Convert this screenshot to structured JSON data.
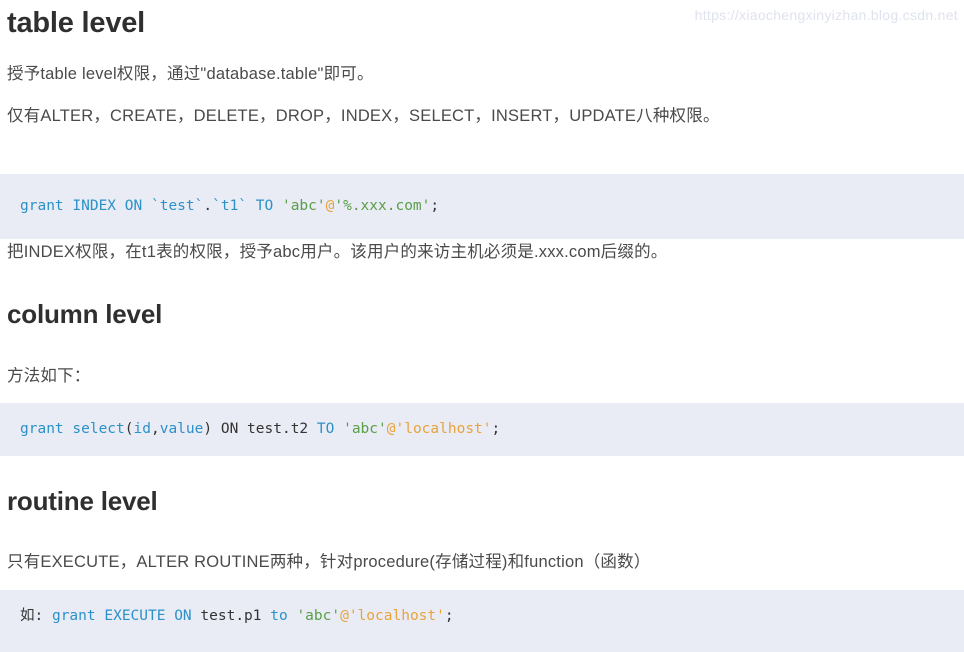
{
  "document": {
    "sections": [
      {
        "heading": "table level",
        "paragraphs": [
          "授予table level权限，通过\"database.table\"即可。",
          "仅有ALTER，CREATE，DELETE，DROP，INDEX，SELECT，INSERT，UPDATE八种权限。"
        ],
        "after_code_paragraph": "把INDEX权限，在t1表的权限，授予abc用户。该用户的来访主机必须是.xxx.com后缀的。"
      },
      {
        "heading": "column level",
        "paragraphs": [
          "方法如下："
        ]
      },
      {
        "heading": "routine level",
        "paragraphs": [
          "只有EXECUTE，ALTER ROUTINE两种，针对procedure(存储过程)和function（函数）"
        ]
      }
    ],
    "code_blocks": [
      {
        "id": "grant-index-table",
        "plain_text": "grant INDEX ON `test`.`t1` TO 'abc'@'%.xxx.com';",
        "tokens": [
          {
            "text": "grant",
            "type": "kw"
          },
          {
            "text": " ",
            "type": "plain"
          },
          {
            "text": "INDEX",
            "type": "kw"
          },
          {
            "text": " ",
            "type": "plain"
          },
          {
            "text": "ON",
            "type": "kw"
          },
          {
            "text": " ",
            "type": "plain"
          },
          {
            "text": "`test`",
            "type": "id"
          },
          {
            "text": ".",
            "type": "punc"
          },
          {
            "text": "`t1`",
            "type": "id"
          },
          {
            "text": " ",
            "type": "plain"
          },
          {
            "text": "TO",
            "type": "kw"
          },
          {
            "text": " ",
            "type": "plain"
          },
          {
            "text": "'abc'",
            "type": "str"
          },
          {
            "text": "@",
            "type": "at"
          },
          {
            "text": "'%.xxx.com'",
            "type": "str"
          },
          {
            "text": ";",
            "type": "punc"
          }
        ]
      },
      {
        "id": "grant-select-column",
        "plain_text": "grant select(id,value) ON test.t2 TO 'abc'@'localhost';",
        "tokens": [
          {
            "text": "grant",
            "type": "kw"
          },
          {
            "text": " ",
            "type": "plain"
          },
          {
            "text": "select",
            "type": "kw"
          },
          {
            "text": "(",
            "type": "punc"
          },
          {
            "text": "id",
            "type": "id"
          },
          {
            "text": ",",
            "type": "punc"
          },
          {
            "text": "value",
            "type": "id"
          },
          {
            "text": ")",
            "type": "punc"
          },
          {
            "text": " ",
            "type": "plain"
          },
          {
            "text": "ON",
            "type": "plain"
          },
          {
            "text": " ",
            "type": "plain"
          },
          {
            "text": "test.t2",
            "type": "plain"
          },
          {
            "text": " ",
            "type": "plain"
          },
          {
            "text": "TO",
            "type": "kw"
          },
          {
            "text": " ",
            "type": "plain"
          },
          {
            "text": "'abc'",
            "type": "str"
          },
          {
            "text": "@",
            "type": "at"
          },
          {
            "text": "'localhost'",
            "type": "str2"
          },
          {
            "text": ";",
            "type": "punc"
          }
        ]
      },
      {
        "id": "grant-execute-routine",
        "plain_text": "如: grant EXECUTE ON test.p1 to 'abc'@'localhost';",
        "tokens": [
          {
            "text": "如:",
            "type": "cn"
          },
          {
            "text": " ",
            "type": "plain"
          },
          {
            "text": "grant",
            "type": "kw"
          },
          {
            "text": " ",
            "type": "plain"
          },
          {
            "text": "EXECUTE",
            "type": "kw"
          },
          {
            "text": " ",
            "type": "plain"
          },
          {
            "text": "ON",
            "type": "kw"
          },
          {
            "text": " ",
            "type": "plain"
          },
          {
            "text": "test.p1",
            "type": "plain"
          },
          {
            "text": " ",
            "type": "plain"
          },
          {
            "text": "to",
            "type": "kw"
          },
          {
            "text": " ",
            "type": "plain"
          },
          {
            "text": "'abc'",
            "type": "str"
          },
          {
            "text": "@",
            "type": "at"
          },
          {
            "text": "'localhost'",
            "type": "str2"
          },
          {
            "text": ";",
            "type": "punc"
          }
        ]
      }
    ],
    "watermark": "https://xiaochengxinyizhan.blog.csdn.net"
  },
  "colors": {
    "code_background": "#e9ecf5",
    "keyword": "#2b91c7",
    "string_green": "#5a9e4a",
    "string_orange": "#e8a33d",
    "heading": "#2f2f2f",
    "body_text": "#4a4a4a",
    "watermark": "#dfe3ef"
  }
}
